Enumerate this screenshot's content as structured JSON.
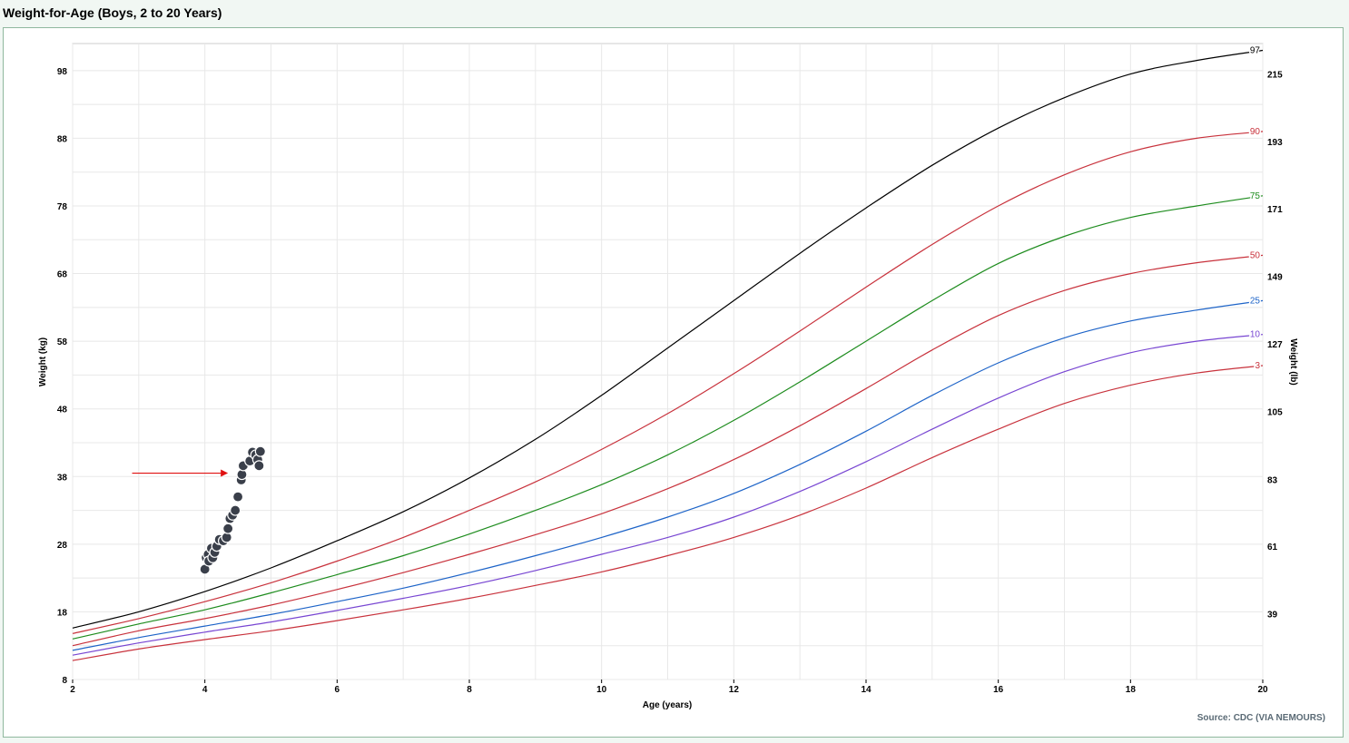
{
  "page": {
    "title": "Weight-for-Age (Boys, 2 to 20 Years)"
  },
  "chart_data": {
    "type": "line",
    "title": "Weight-for-Age (Boys, 2 to 20 Years)",
    "xlabel": "Age (years)",
    "ylabel": "Weight (kg)",
    "ylabel_right": "Weight (lb)",
    "source": "Source: CDC (VIA NEMOURS)",
    "xlim": [
      2,
      20
    ],
    "ylim": [
      8,
      102
    ],
    "x_ticks": [
      2,
      4,
      6,
      8,
      10,
      12,
      14,
      16,
      18,
      20
    ],
    "y_ticks": [
      8,
      18,
      28,
      38,
      48,
      58,
      68,
      78,
      88,
      98
    ],
    "right_ticks": [
      {
        "label": "39",
        "kg": 17.7
      },
      {
        "label": "61",
        "kg": 27.7
      },
      {
        "label": "83",
        "kg": 37.6
      },
      {
        "label": "105",
        "kg": 47.6
      },
      {
        "label": "127",
        "kg": 57.6
      },
      {
        "label": "149",
        "kg": 67.6
      },
      {
        "label": "171",
        "kg": 77.6
      },
      {
        "label": "193",
        "kg": 87.5
      },
      {
        "label": "215",
        "kg": 97.5
      }
    ],
    "grid": true,
    "x": [
      2,
      3,
      4,
      5,
      6,
      7,
      8,
      9,
      10,
      11,
      12,
      13,
      14,
      15,
      16,
      17,
      18,
      19,
      20
    ],
    "series": [
      {
        "name": "97",
        "color": "#000000",
        "values": [
          15.6,
          18.0,
          21.0,
          24.5,
          28.5,
          32.8,
          37.8,
          43.5,
          50.0,
          57.0,
          64.0,
          71.0,
          77.7,
          84.0,
          89.5,
          94.0,
          97.5,
          99.5,
          101.0
        ]
      },
      {
        "name": "90",
        "color": "#c8323c",
        "values": [
          14.8,
          17.0,
          19.5,
          22.3,
          25.5,
          29.0,
          33.0,
          37.2,
          42.0,
          47.3,
          53.2,
          59.5,
          66.0,
          72.3,
          78.0,
          82.6,
          86.0,
          88.0,
          89.0
        ]
      },
      {
        "name": "75",
        "color": "#1e8c1e",
        "values": [
          14.0,
          16.2,
          18.3,
          20.8,
          23.5,
          26.3,
          29.5,
          33.0,
          36.8,
          41.2,
          46.3,
          52.0,
          58.0,
          64.0,
          69.5,
          73.5,
          76.3,
          78.0,
          79.5
        ]
      },
      {
        "name": "50",
        "color": "#c8323c",
        "values": [
          13.0,
          15.2,
          17.0,
          19.0,
          21.3,
          23.8,
          26.5,
          29.4,
          32.5,
          36.2,
          40.5,
          45.5,
          51.0,
          56.7,
          61.8,
          65.5,
          68.0,
          69.6,
          70.7
        ]
      },
      {
        "name": "25",
        "color": "#1e64c8",
        "values": [
          12.3,
          14.2,
          15.9,
          17.6,
          19.5,
          21.5,
          23.8,
          26.3,
          29.0,
          32.0,
          35.5,
          39.8,
          44.7,
          50.0,
          54.8,
          58.5,
          61.0,
          62.6,
          64.0
        ]
      },
      {
        "name": "10",
        "color": "#7846d2",
        "values": [
          11.6,
          13.4,
          15.0,
          16.5,
          18.2,
          20.0,
          21.9,
          24.1,
          26.5,
          29.0,
          32.0,
          35.8,
          40.2,
          45.0,
          49.6,
          53.5,
          56.3,
          58.0,
          59.0
        ]
      },
      {
        "name": "3",
        "color": "#c8323c",
        "values": [
          10.8,
          12.5,
          13.9,
          15.2,
          16.7,
          18.3,
          20.0,
          21.9,
          23.9,
          26.3,
          29.0,
          32.3,
          36.3,
          40.8,
          45.0,
          48.8,
          51.5,
          53.3,
          54.4
        ]
      }
    ],
    "points": [
      {
        "x": 4.0,
        "y": 24.3
      },
      {
        "x": 4.02,
        "y": 26.0
      },
      {
        "x": 4.05,
        "y": 26.5
      },
      {
        "x": 4.06,
        "y": 25.5
      },
      {
        "x": 4.1,
        "y": 27.4
      },
      {
        "x": 4.12,
        "y": 26.0
      },
      {
        "x": 4.15,
        "y": 26.8
      },
      {
        "x": 4.18,
        "y": 27.7
      },
      {
        "x": 4.22,
        "y": 28.7
      },
      {
        "x": 4.28,
        "y": 28.5
      },
      {
        "x": 4.33,
        "y": 29.0
      },
      {
        "x": 4.35,
        "y": 30.3
      },
      {
        "x": 4.38,
        "y": 31.8
      },
      {
        "x": 4.42,
        "y": 32.3
      },
      {
        "x": 4.46,
        "y": 33.0
      },
      {
        "x": 4.5,
        "y": 35.0
      },
      {
        "x": 4.55,
        "y": 37.5
      },
      {
        "x": 4.56,
        "y": 38.3
      },
      {
        "x": 4.58,
        "y": 39.6
      },
      {
        "x": 4.68,
        "y": 40.3
      },
      {
        "x": 4.72,
        "y": 41.6
      },
      {
        "x": 4.77,
        "y": 41.2
      },
      {
        "x": 4.8,
        "y": 40.5
      },
      {
        "x": 4.82,
        "y": 39.6
      },
      {
        "x": 4.84,
        "y": 41.7
      }
    ],
    "point_color": "#3a3f4a",
    "annotation_arrow": {
      "x_from": 2.9,
      "x_to": 4.35,
      "y": 38.5,
      "color": "#e01010"
    }
  }
}
